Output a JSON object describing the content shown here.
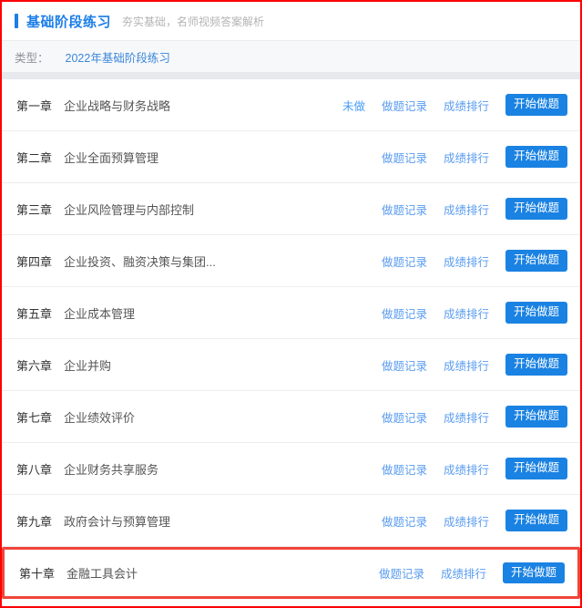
{
  "header": {
    "title": "基础阶段练习",
    "subtitle": "夯实基础，名师视频答案解析"
  },
  "filter": {
    "label": "类型：",
    "selected_option": "2022年基础阶段练习"
  },
  "actions": {
    "record_label": "做题记录",
    "ranking_label": "成绩排行",
    "start_label": "开始做题",
    "not_done_label": "未做"
  },
  "colors": {
    "accent_blue": "#1a7ee8",
    "link_blue": "#5a9cf0",
    "button_blue": "#1a82e2",
    "highlight_red": "#f0453a",
    "page_border_red": "#ff0000",
    "gap_gray": "#e7e9ec",
    "filter_bg": "#f7f8fa"
  },
  "chapters": [
    {
      "number": "第一章",
      "title": "企业战略与财务战略",
      "status": "未做",
      "record": "做题记录",
      "ranking": "成绩排行",
      "start": "开始做题",
      "highlighted": false
    },
    {
      "number": "第二章",
      "title": "企业全面预算管理",
      "status": "",
      "record": "做题记录",
      "ranking": "成绩排行",
      "start": "开始做题",
      "highlighted": false
    },
    {
      "number": "第三章",
      "title": "企业风险管理与内部控制",
      "status": "",
      "record": "做题记录",
      "ranking": "成绩排行",
      "start": "开始做题",
      "highlighted": false
    },
    {
      "number": "第四章",
      "title": "企业投资、融资决策与集团...",
      "status": "",
      "record": "做题记录",
      "ranking": "成绩排行",
      "start": "开始做题",
      "highlighted": false
    },
    {
      "number": "第五章",
      "title": "企业成本管理",
      "status": "",
      "record": "做题记录",
      "ranking": "成绩排行",
      "start": "开始做题",
      "highlighted": false
    },
    {
      "number": "第六章",
      "title": "企业并购",
      "status": "",
      "record": "做题记录",
      "ranking": "成绩排行",
      "start": "开始做题",
      "highlighted": false
    },
    {
      "number": "第七章",
      "title": "企业绩效评价",
      "status": "",
      "record": "做题记录",
      "ranking": "成绩排行",
      "start": "开始做题",
      "highlighted": false
    },
    {
      "number": "第八章",
      "title": "企业财务共享服务",
      "status": "",
      "record": "做题记录",
      "ranking": "成绩排行",
      "start": "开始做题",
      "highlighted": false
    },
    {
      "number": "第九章",
      "title": "政府会计与预算管理",
      "status": "",
      "record": "做题记录",
      "ranking": "成绩排行",
      "start": "开始做题",
      "highlighted": false
    },
    {
      "number": "第十章",
      "title": "金融工具会计",
      "status": "",
      "record": "做题记录",
      "ranking": "成绩排行",
      "start": "开始做题",
      "highlighted": true
    }
  ]
}
